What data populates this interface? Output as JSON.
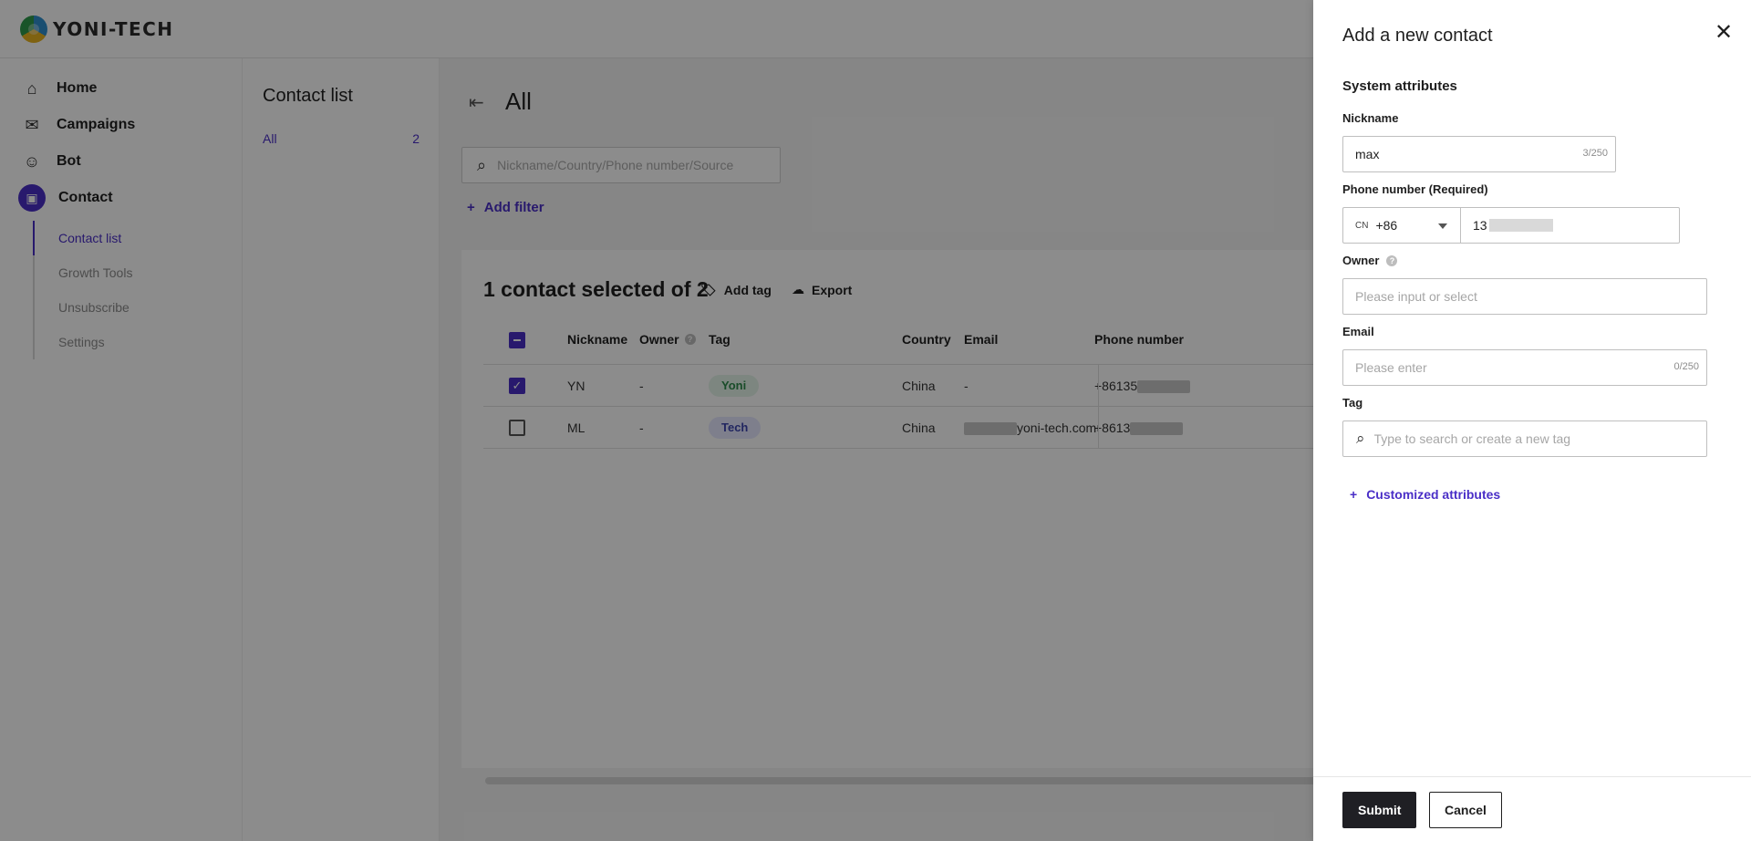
{
  "app": {
    "logo_text": "YONI-TECH"
  },
  "sidebar": {
    "items": [
      {
        "label": "Home",
        "icon": "home-icon"
      },
      {
        "label": "Campaigns",
        "icon": "campaigns-icon"
      },
      {
        "label": "Bot",
        "icon": "bot-icon"
      },
      {
        "label": "Contact",
        "icon": "contact-icon"
      }
    ],
    "subitems": [
      {
        "label": "Contact list"
      },
      {
        "label": "Growth Tools"
      },
      {
        "label": "Unsubscribe"
      },
      {
        "label": "Settings"
      }
    ]
  },
  "list_panel": {
    "title": "Contact list",
    "group_label": "All",
    "group_count": "2"
  },
  "main": {
    "title": "All",
    "search_placeholder": "Nickname/Country/Phone number/Source",
    "add_filter": "Add filter",
    "selection_text": "1 contact selected of 2",
    "add_tag": "Add tag",
    "export": "Export",
    "columns": [
      "Nickname",
      "Owner",
      "Tag",
      "Country",
      "Email",
      "Phone number"
    ],
    "rows": [
      {
        "nickname": "YN",
        "owner": "-",
        "tag": "Yoni",
        "country": "China",
        "email": "-",
        "email_suffix": "",
        "phone": "+86135"
      },
      {
        "nickname": "ML",
        "owner": "-",
        "tag": "Tech",
        "country": "China",
        "email": "",
        "email_suffix": "yoni-tech.com",
        "phone": "+8613"
      }
    ]
  },
  "drawer": {
    "title": "Add a new contact",
    "section": "System attributes",
    "nickname_label": "Nickname",
    "nickname_value": "max",
    "nickname_counter": "3/250",
    "phone_label": "Phone number (Required)",
    "country_code_abbr": "CN",
    "country_code": "+86",
    "phone_value": "13",
    "owner_label": "Owner",
    "owner_placeholder": "Please input or select",
    "email_label": "Email",
    "email_placeholder": "Please enter",
    "email_counter": "0/250",
    "tag_label": "Tag",
    "tag_placeholder": "Type to search or create a new tag",
    "custom_attrs": "Customized attributes",
    "submit": "Submit",
    "cancel": "Cancel"
  },
  "colors": {
    "accent": "#4a2fc7",
    "submit_bg": "#1f1f24",
    "overlay": "rgba(0,0,0,0.45)"
  }
}
